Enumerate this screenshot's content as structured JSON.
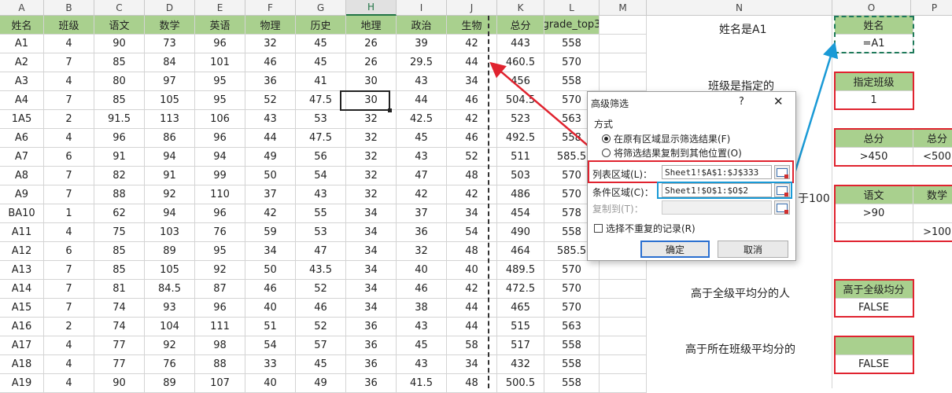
{
  "columns": [
    "A",
    "B",
    "C",
    "D",
    "E",
    "F",
    "G",
    "H",
    "I",
    "J",
    "K",
    "L",
    "M",
    "N",
    "O",
    "P"
  ],
  "selected_column": "H",
  "headers": [
    "姓名",
    "班级",
    "语文",
    "数学",
    "英语",
    "物理",
    "历史",
    "地理",
    "政治",
    "生物",
    "总分",
    "grade_top3"
  ],
  "rows": [
    [
      "A1",
      "4",
      "90",
      "73",
      "96",
      "32",
      "45",
      "26",
      "39",
      "42",
      "443",
      "558"
    ],
    [
      "A2",
      "7",
      "85",
      "84",
      "101",
      "46",
      "45",
      "26",
      "29.5",
      "44",
      "460.5",
      "570"
    ],
    [
      "A3",
      "4",
      "80",
      "97",
      "95",
      "36",
      "41",
      "30",
      "43",
      "34",
      "456",
      "558"
    ],
    [
      "A4",
      "7",
      "85",
      "105",
      "95",
      "52",
      "47.5",
      "30",
      "44",
      "46",
      "504.5",
      "570"
    ],
    [
      "1A5",
      "2",
      "91.5",
      "113",
      "106",
      "43",
      "53",
      "32",
      "42.5",
      "42",
      "523",
      "563"
    ],
    [
      "A6",
      "4",
      "96",
      "86",
      "96",
      "44",
      "47.5",
      "32",
      "45",
      "46",
      "492.5",
      "558"
    ],
    [
      "A7",
      "6",
      "91",
      "94",
      "94",
      "49",
      "56",
      "32",
      "43",
      "52",
      "511",
      "585.5"
    ],
    [
      "A8",
      "7",
      "82",
      "91",
      "99",
      "50",
      "54",
      "32",
      "47",
      "48",
      "503",
      "570"
    ],
    [
      "A9",
      "7",
      "88",
      "92",
      "110",
      "37",
      "43",
      "32",
      "42",
      "42",
      "486",
      "570"
    ],
    [
      "BA10",
      "1",
      "62",
      "94",
      "96",
      "42",
      "55",
      "34",
      "37",
      "34",
      "454",
      "578"
    ],
    [
      "A11",
      "4",
      "75",
      "103",
      "76",
      "59",
      "53",
      "34",
      "36",
      "54",
      "490",
      "558"
    ],
    [
      "A12",
      "6",
      "85",
      "89",
      "95",
      "34",
      "47",
      "34",
      "32",
      "48",
      "464",
      "585.5"
    ],
    [
      "A13",
      "7",
      "85",
      "105",
      "92",
      "50",
      "43.5",
      "34",
      "40",
      "40",
      "489.5",
      "570"
    ],
    [
      "A14",
      "7",
      "81",
      "84.5",
      "87",
      "46",
      "52",
      "34",
      "46",
      "42",
      "472.5",
      "570"
    ],
    [
      "A15",
      "7",
      "74",
      "93",
      "96",
      "40",
      "46",
      "34",
      "38",
      "44",
      "465",
      "570"
    ],
    [
      "A16",
      "2",
      "74",
      "104",
      "111",
      "51",
      "52",
      "36",
      "43",
      "44",
      "515",
      "563"
    ],
    [
      "A17",
      "4",
      "77",
      "92",
      "98",
      "54",
      "57",
      "36",
      "45",
      "58",
      "517",
      "558"
    ],
    [
      "A18",
      "4",
      "77",
      "76",
      "88",
      "33",
      "45",
      "36",
      "43",
      "34",
      "432",
      "558"
    ],
    [
      "A19",
      "4",
      "90",
      "89",
      "107",
      "40",
      "49",
      "36",
      "41.5",
      "48",
      "500.5",
      "558"
    ]
  ],
  "notes": {
    "n1": "姓名是A1",
    "n4": "班级是指定的",
    "n10_partial": "于100",
    "n15": "高于全级平均分的人",
    "n18": "高于所在班级平均分的"
  },
  "criteria": {
    "name_header": "姓名",
    "name_value": "=A1",
    "class_header": "指定班级",
    "class_value": "1",
    "total_header1": "总分",
    "total_header2": "总分",
    "total_cond1": ">450",
    "total_cond2": "<500",
    "chinese_header": "语文",
    "math_header": "数学",
    "chinese_cond": ">90",
    "math_cond": ">100",
    "avg_header": "高于全级均分",
    "avg_value": "FALSE",
    "class_avg_value": "FALSE"
  },
  "dialog": {
    "title": "高级筛选",
    "help": "?",
    "close": "✕",
    "group_label": "方式",
    "radio1": "在原有区域显示筛选结果(F)",
    "radio2": "将筛选结果复制到其他位置(O)",
    "list_range_label": "列表区域(L)：",
    "list_range_value": "Sheet1!$A$1:$J$333",
    "criteria_range_label": "条件区域(C)：",
    "criteria_range_value": "Sheet1!$O$1:$O$2",
    "copy_to_label": "复制到(T)：",
    "unique_label": "选择不重复的记录(R)",
    "ok": "确定",
    "cancel": "取消"
  },
  "colors": {
    "header_green": "#a9d08e",
    "arrow_red": "#e0232f",
    "arrow_blue": "#1a9ad6",
    "box_blue": "#1a9ad6"
  }
}
